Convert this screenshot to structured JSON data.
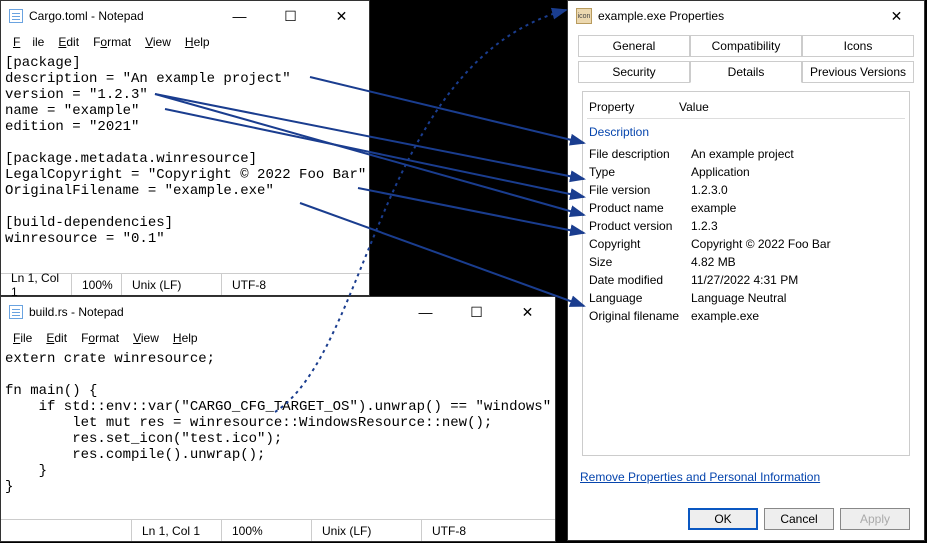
{
  "notepad1": {
    "title": "Cargo.toml - Notepad",
    "menu": {
      "file": "File",
      "edit": "Edit",
      "format": "Format",
      "view": "View",
      "help": "Help"
    },
    "content": "[package]\ndescription = \"An example project\"\nversion = \"1.2.3\"\nname = \"example\"\nedition = \"2021\"\n\n[package.metadata.winresource]\nLegalCopyright = \"Copyright © 2022 Foo Bar\"\nOriginalFilename = \"example.exe\"\n\n[build-dependencies]\nwinresource = \"0.1\"",
    "status": {
      "pos": "Ln 1, Col 1",
      "zoom": "100%",
      "eol": "Unix (LF)",
      "enc": "UTF-8"
    }
  },
  "notepad2": {
    "title": "build.rs - Notepad",
    "menu": {
      "file": "File",
      "edit": "Edit",
      "format": "Format",
      "view": "View",
      "help": "Help"
    },
    "content": "extern crate winresource;\n\nfn main() {\n    if std::env::var(\"CARGO_CFG_TARGET_OS\").unwrap() == \"windows\" {\n        let mut res = winresource::WindowsResource::new();\n        res.set_icon(\"test.ico\");\n        res.compile().unwrap();\n    }\n}",
    "status": {
      "pos": "Ln 1, Col 1",
      "zoom": "100%",
      "eol": "Unix (LF)",
      "enc": "UTF-8"
    }
  },
  "properties": {
    "title": "example.exe Properties",
    "tabs1": [
      "General",
      "Compatibility",
      "Icons"
    ],
    "tabs2": [
      "Security",
      "Details",
      "Previous Versions"
    ],
    "active_tab": "Details",
    "header": {
      "prop": "Property",
      "val": "Value"
    },
    "section": "Description",
    "rows": [
      {
        "k": "File description",
        "v": "An example project"
      },
      {
        "k": "Type",
        "v": "Application"
      },
      {
        "k": "File version",
        "v": "1.2.3.0"
      },
      {
        "k": "Product name",
        "v": "example"
      },
      {
        "k": "Product version",
        "v": "1.2.3"
      },
      {
        "k": "Copyright",
        "v": "Copyright © 2022 Foo Bar"
      },
      {
        "k": "Size",
        "v": "4.82 MB"
      },
      {
        "k": "Date modified",
        "v": "11/27/2022 4:31 PM"
      },
      {
        "k": "Language",
        "v": "Language Neutral"
      },
      {
        "k": "Original filename",
        "v": "example.exe"
      }
    ],
    "remove_link": "Remove Properties and Personal Information",
    "buttons": {
      "ok": "OK",
      "cancel": "Cancel",
      "apply": "Apply"
    }
  },
  "window_controls": {
    "min": "—",
    "max": "☐",
    "close": "✕"
  }
}
